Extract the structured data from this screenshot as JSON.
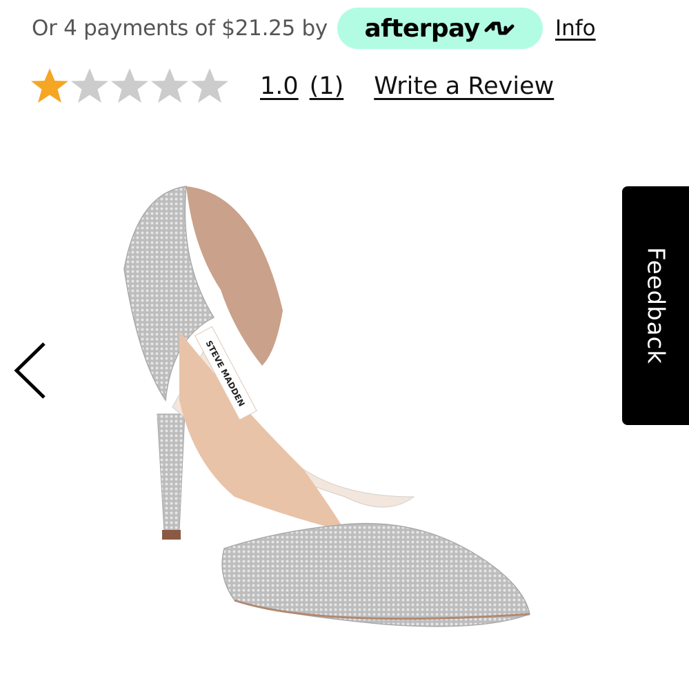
{
  "afterpay": {
    "text": "Or 4 payments of $21.25 by",
    "logo": "afterpay",
    "logo_icon": "afterpay-arrows-icon",
    "info_label": "Info",
    "badge_color": "#b2fce4"
  },
  "rating": {
    "stars_filled": 1,
    "stars_total": 5,
    "filled_color": "#f5a623",
    "empty_color": "#cccccc",
    "value": "1.0",
    "count": "(1)",
    "write_review_label": "Write a Review"
  },
  "gallery": {
    "prev_icon": "chevron-left-icon",
    "image_brand_label": "STEVE MADDEN"
  },
  "feedback": {
    "label": "Feedback",
    "bg_color": "#000000"
  }
}
